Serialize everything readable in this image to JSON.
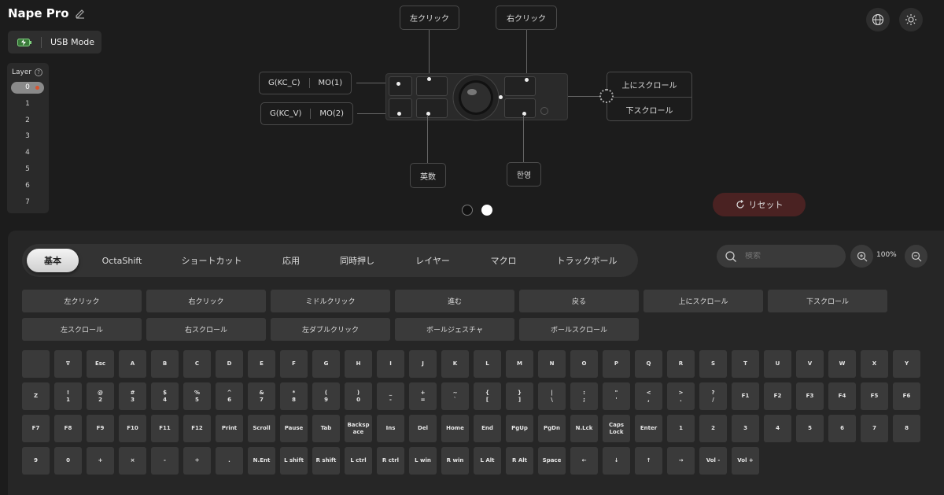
{
  "header": {
    "device_name": "Nape Pro"
  },
  "mode": {
    "label": "USB Mode"
  },
  "layers": {
    "title": "Layer",
    "items": [
      "0",
      "1",
      "2",
      "3",
      "4",
      "5",
      "6",
      "7"
    ]
  },
  "callouts": {
    "left_click": "左クリック",
    "right_click": "右クリック",
    "btn1_a": "G(KC_C)",
    "btn1_b": "MO(1)",
    "btn2_a": "G(KC_V)",
    "btn2_b": "MO(2)",
    "scroll_up": "上にスクロール",
    "scroll_down": "下スクロール",
    "bottom_left": "英数",
    "bottom_right": "한영"
  },
  "reset": {
    "label": "リセット"
  },
  "tabs": [
    "基本",
    "OctaShift",
    "ショートカット",
    "応用",
    "同時押し",
    "レイヤー",
    "マクロ",
    "トラックボール"
  ],
  "search": {
    "placeholder": "検索"
  },
  "zoom": {
    "level": "100%"
  },
  "mouse_buttons": [
    [
      "左クリック",
      "右クリック",
      "ミドルクリック",
      "進む",
      "戻る",
      "上にスクロール",
      "下スクロール"
    ],
    [
      "左スクロール",
      "右スクロール",
      "左ダブルクリック",
      "ボールジェスチャ",
      "ボールスクロール"
    ]
  ],
  "keys": [
    [
      "",
      "∇",
      "Esc",
      "A",
      "B",
      "C",
      "D",
      "E",
      "F",
      "G",
      "H",
      "I",
      "J",
      "K",
      "L",
      "M",
      "N",
      "O",
      "P",
      "Q",
      "R",
      "S",
      "T",
      "U",
      "V",
      "W",
      "X",
      "Y"
    ],
    [
      "Z",
      "!\n1",
      "@\n2",
      "#\n3",
      "$\n4",
      "%\n5",
      "^\n6",
      "&\n7",
      "*\n8",
      "(\n9",
      ")\n0",
      "_\n-",
      "+\n=",
      "~\n`",
      "{\n[",
      "}\n]",
      "|\n\\",
      ":\n;",
      "\"\n'",
      "<\n,",
      ">\n.",
      "?\n/",
      "F1",
      "F2",
      "F3",
      "F4",
      "F5",
      "F6"
    ],
    [
      "F7",
      "F8",
      "F9",
      "F10",
      "F11",
      "F12",
      "Print",
      "Scroll",
      "Pause",
      "Tab",
      "Backsp\nace",
      "Ins",
      "Del",
      "Home",
      "End",
      "PgUp",
      "PgDn",
      "N.Lck",
      "Caps\nLock",
      "Enter",
      "1",
      "2",
      "3",
      "4",
      "5",
      "6",
      "7",
      "8"
    ],
    [
      "9",
      "0",
      "+",
      "×",
      "-",
      "÷",
      ".",
      "N.Ent",
      "L shift",
      "R shift",
      "L ctrl",
      "R ctrl",
      "L win",
      "R win",
      "L Alt",
      "R Alt",
      "Space",
      "←",
      "↓",
      "↑",
      "→",
      "Vol -",
      "Vol +"
    ]
  ]
}
